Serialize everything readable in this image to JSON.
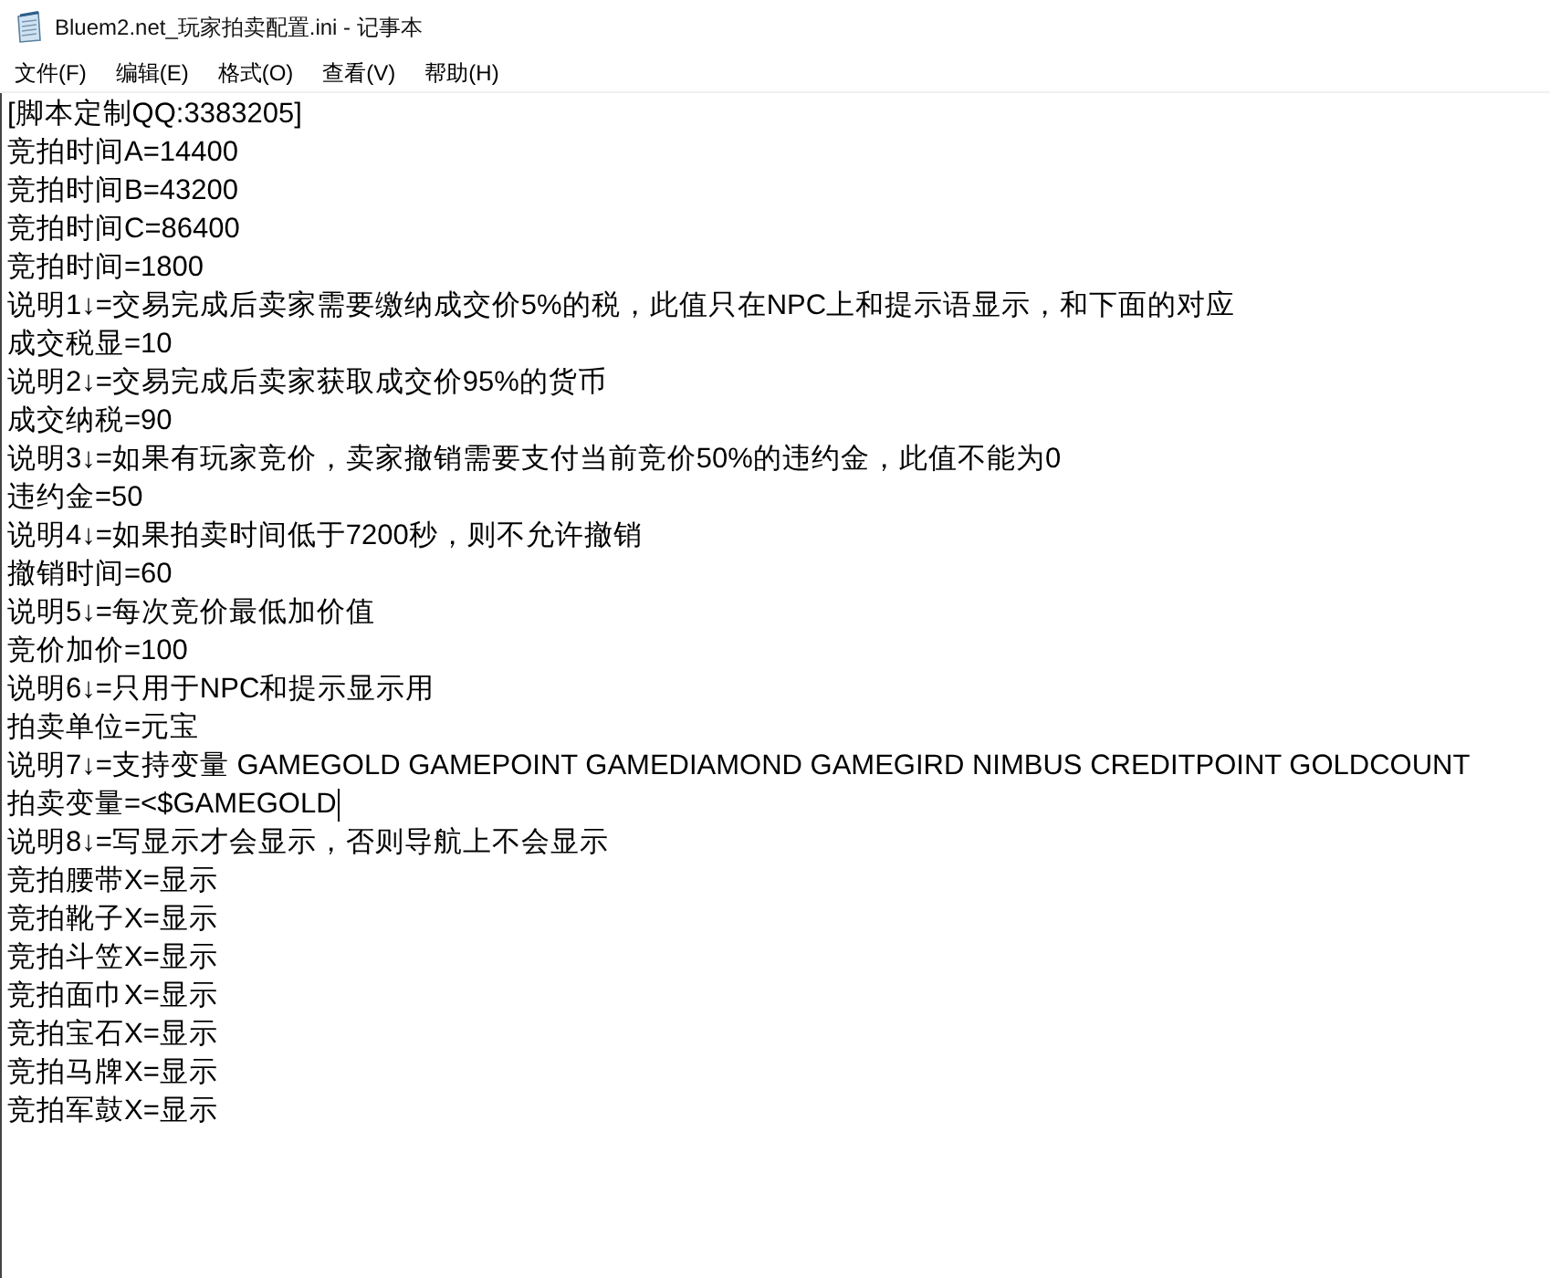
{
  "window": {
    "title": "Bluem2.net_玩家拍卖配置.ini - 记事本"
  },
  "menu": [
    "文件(F)",
    "编辑(E)",
    "格式(O)",
    "查看(V)",
    "帮助(H)"
  ],
  "editor": {
    "lines": [
      {
        "text": "[脚本定制QQ:3383205]",
        "caret": false
      },
      {
        "text": "竞拍时间A=14400",
        "caret": false
      },
      {
        "text": "竞拍时间B=43200",
        "caret": false
      },
      {
        "text": "竞拍时间C=86400",
        "caret": false
      },
      {
        "text": "竞拍时间=1800",
        "caret": false
      },
      {
        "text": "说明1↓=交易完成后卖家需要缴纳成交价5%的税，此值只在NPC上和提示语显示，和下面的对应",
        "caret": false
      },
      {
        "text": "成交税显=10",
        "caret": false
      },
      {
        "text": "说明2↓=交易完成后卖家获取成交价95%的货币",
        "caret": false
      },
      {
        "text": "成交纳税=90",
        "caret": false
      },
      {
        "text": "说明3↓=如果有玩家竞价，卖家撤销需要支付当前竞价50%的违约金，此值不能为0",
        "caret": false
      },
      {
        "text": "违约金=50",
        "caret": false
      },
      {
        "text": "说明4↓=如果拍卖时间低于7200秒，则不允许撤销",
        "caret": false
      },
      {
        "text": "撤销时间=60",
        "caret": false
      },
      {
        "text": "说明5↓=每次竞价最低加价值",
        "caret": false
      },
      {
        "text": "竞价加价=100",
        "caret": false
      },
      {
        "text": "说明6↓=只用于NPC和提示显示用",
        "caret": false
      },
      {
        "text": "拍卖单位=元宝",
        "caret": false
      },
      {
        "text": "说明7↓=支持变量 GAMEGOLD GAMEPOINT GAMEDIAMOND GAMEGIRD NIMBUS CREDITPOINT GOLDCOUNT",
        "caret": false
      },
      {
        "text": "拍卖变量=<$GAMEGOLD",
        "caret": true
      },
      {
        "text": "说明8↓=写显示才会显示，否则导航上不会显示",
        "caret": false
      },
      {
        "text": "竞拍腰带X=显示",
        "caret": false
      },
      {
        "text": "竞拍靴子X=显示",
        "caret": false
      },
      {
        "text": "竞拍斗笠X=显示",
        "caret": false
      },
      {
        "text": "竞拍面巾X=显示",
        "caret": false
      },
      {
        "text": "竞拍宝石X=显示",
        "caret": false
      },
      {
        "text": "竞拍马牌X=显示",
        "caret": false
      },
      {
        "text": "竞拍军鼓X=显示",
        "caret": false
      }
    ]
  }
}
